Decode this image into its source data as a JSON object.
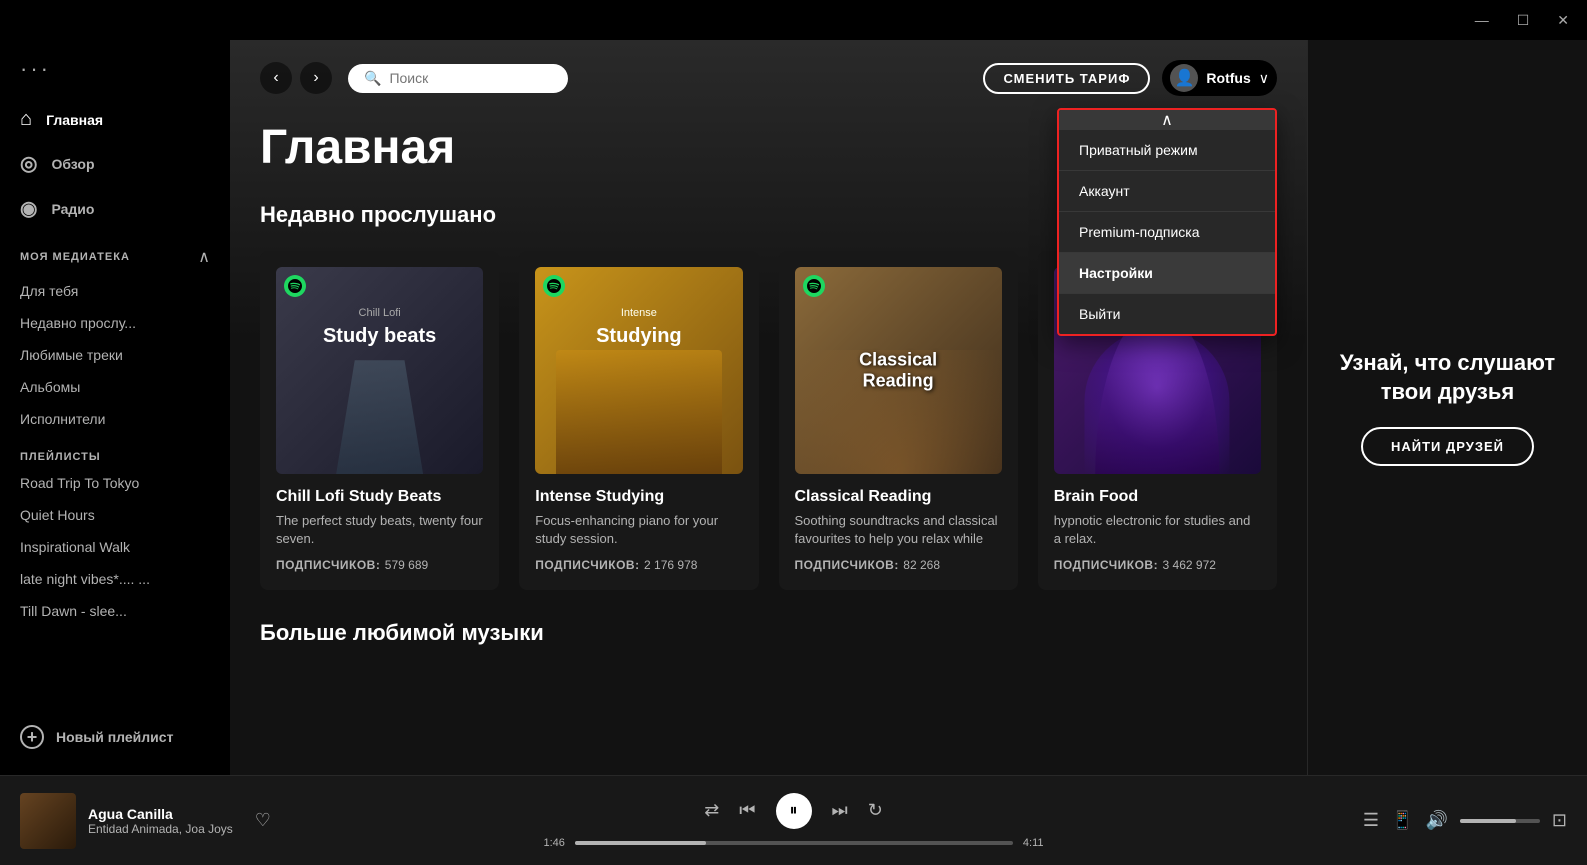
{
  "titlebar": {
    "minimize": "—",
    "maximize": "☐",
    "close": "✕"
  },
  "sidebar": {
    "dots": "···",
    "nav": [
      {
        "id": "home",
        "icon": "⌂",
        "label": "Главная",
        "active": true
      },
      {
        "id": "browse",
        "icon": "◎",
        "label": "Обзор",
        "active": false
      },
      {
        "id": "radio",
        "icon": "◉",
        "label": "Радио",
        "active": false
      }
    ],
    "my_library_label": "МОЯ МЕДИАТЕКА",
    "library_items": [
      {
        "id": "foryou",
        "label": "Для тебя"
      },
      {
        "id": "recent",
        "label": "Недавно прослу..."
      },
      {
        "id": "favorites",
        "label": "Любимые треки"
      },
      {
        "id": "albums",
        "label": "Альбомы"
      },
      {
        "id": "artists",
        "label": "Исполнители"
      }
    ],
    "playlists_label": "ПЛЕЙЛИСТЫ",
    "playlists": [
      {
        "id": "roadtrip",
        "label": "Road Trip To Tokyo"
      },
      {
        "id": "quiethours",
        "label": "Quiet Hours"
      },
      {
        "id": "inspirational",
        "label": "Inspirational Walk"
      },
      {
        "id": "latenight",
        "label": "late night vibes*.... ..."
      },
      {
        "id": "tilldawn",
        "label": "Till Dawn - slee..."
      }
    ],
    "new_playlist": "Новый плейлист"
  },
  "topbar": {
    "back_arrow": "‹",
    "forward_arrow": "›",
    "search_placeholder": "Поиск",
    "upgrade_btn": "СМЕНИТЬ ТАРИФ",
    "user_name": "Rotfus",
    "chevron": "∨"
  },
  "dropdown": {
    "scroll_indicator": "∧",
    "items": [
      {
        "id": "private",
        "label": "Приватный режим",
        "active": false
      },
      {
        "id": "account",
        "label": "Аккаунт",
        "active": false
      },
      {
        "id": "premium",
        "label": "Premium-подписка",
        "active": false
      },
      {
        "id": "settings",
        "label": "Настройки",
        "active": true
      },
      {
        "id": "logout",
        "label": "Выйти",
        "active": false
      }
    ]
  },
  "main": {
    "page_title": "Главная",
    "recent_section_title": "Недавно прослушано",
    "nav_prev": "‹",
    "nav_next": "›",
    "cards": [
      {
        "id": "chill",
        "title": "Chill Lofi Study Beats",
        "desc": "The perfect study beats, twenty four seven.",
        "subs_label": "ПОДПИСЧИКОВ:",
        "subs_count": "579 689",
        "img_class": "img-chill",
        "img_label": "Chill Lofi",
        "img_sublabel": "Study beats"
      },
      {
        "id": "studying",
        "title": "Intense Studying",
        "desc": "Focus-enhancing piano for your study session.",
        "subs_label": "ПОДПИСЧИКОВ:",
        "subs_count": "2 176 978",
        "img_class": "img-study",
        "img_label": "Intense",
        "img_sublabel": "Studying"
      },
      {
        "id": "classical",
        "title": "Classical Reading",
        "desc": "Soothing soundtracks and classical favourites to help you relax while you...",
        "subs_label": "ПОДПИСЧИКОВ:",
        "subs_count": "82 268",
        "img_class": "img-classical",
        "img_label": "Classical",
        "img_sublabel": "Reading"
      },
      {
        "id": "brain",
        "title": "Brain Food",
        "desc": "hypnotic electronic for studies and a relax.",
        "subs_label": "ПОДПИСЧИКОВ:",
        "subs_count": "3 462 972",
        "img_class": "img-brain",
        "img_label": "Brain Food",
        "img_sublabel": ""
      }
    ],
    "more_section_title": "Больше любимой музыки"
  },
  "right_panel": {
    "title": "Узнай, что слушают твои друзья",
    "find_friends_btn": "НАЙТИ ДРУЗЕЙ"
  },
  "player": {
    "song": "Agua Canilla",
    "artist": "Entidad Animada, Joa Joys",
    "current_time": "1:46",
    "total_time": "4:11",
    "progress_pct": 30
  }
}
